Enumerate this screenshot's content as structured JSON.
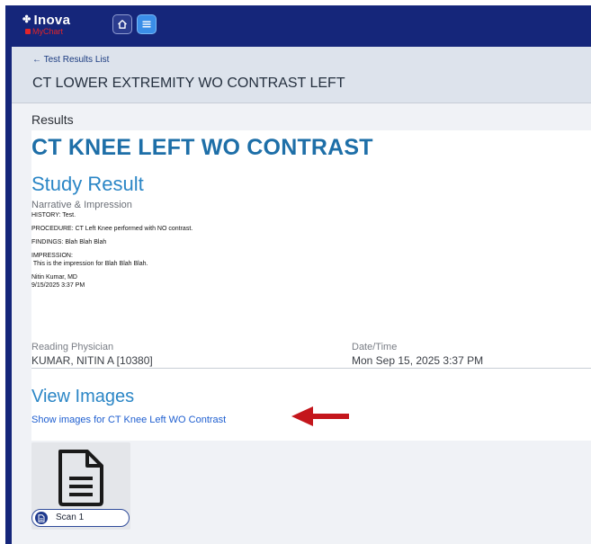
{
  "app": {
    "logo_text": "Inova",
    "logo_subtext": "MyChart",
    "accent_color": "#15267a",
    "link_color": "#1f5fd0",
    "heading_color": "#1e6fa8"
  },
  "nav": {
    "home_icon": "home-icon",
    "menu_icon": "menu-icon"
  },
  "breadcrumb": {
    "back_label": "← Test Results List",
    "title": "CT LOWER EXTREMITY WO CONTRAST LEFT"
  },
  "results": {
    "section_label": "Results",
    "test_title": "CT KNEE LEFT WO CONTRAST",
    "study_heading": "Study Result",
    "narrative_label": "Narrative & Impression",
    "report_lines": {
      "history": "HISTORY: Test.",
      "procedure": "PROCEDURE: CT Left Knee performed with NO contrast.",
      "findings": "FINDINGS: Blah Blah Blah",
      "impression_label": "IMPRESSION:",
      "impression_text": " This is the impression for Blah Blah Blah.",
      "signer": "Nitin Kumar, MD",
      "signed_at": "9/15/2025 3:37 PM"
    },
    "reading_physician_label": "Reading Physician",
    "reading_physician_value": "KUMAR, NITIN A [10380]",
    "datetime_label": "Date/Time",
    "datetime_value": "Mon Sep 15, 2025  3:37 PM",
    "view_images_heading": "View Images",
    "show_images_link": "Show images for CT Knee Left WO Contrast"
  },
  "scan": {
    "icon": "document-icon",
    "label": "Scan 1"
  },
  "annotation": {
    "arrow_color": "#c4161c"
  }
}
